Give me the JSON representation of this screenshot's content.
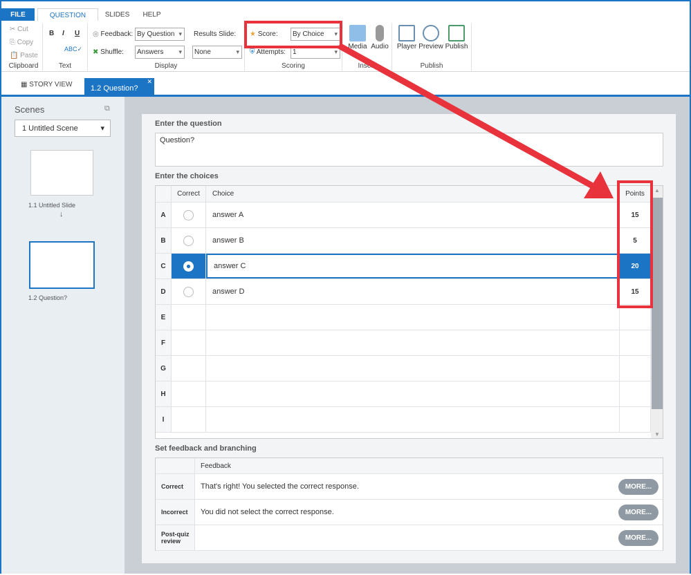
{
  "ribbon_tabs": [
    "FILE",
    "QUESTION",
    "SLIDES",
    "HELP"
  ],
  "clipboard": {
    "cut": "Cut",
    "copy": "Copy",
    "paste": "Paste",
    "group": "Clipboard"
  },
  "text": {
    "bold": "B",
    "italic": "I",
    "underline": "U",
    "group": "Text"
  },
  "display": {
    "feedback_label": "Feedback:",
    "feedback_value": "By Question",
    "shuffle_label": "Shuffle:",
    "shuffle_value": "Answers",
    "results_label": "Results Slide:",
    "results_value": "None",
    "group": "Display"
  },
  "scoring": {
    "score_label": "Score:",
    "score_value": "By Choice",
    "attempts_label": "Attempts:",
    "attempts_value": "1",
    "group": "Scoring"
  },
  "insert": {
    "media": "Media",
    "audio": "Audio",
    "group": "Insert"
  },
  "publish": {
    "player": "Player",
    "preview": "Preview",
    "publish": "Publish",
    "group": "Publish"
  },
  "doc_tabs": {
    "story_view": "STORY VIEW",
    "active": "1.2 Question?"
  },
  "sidebar": {
    "title": "Scenes",
    "scene": "1 Untitled Scene",
    "slides": [
      {
        "label": "1.1 Untitled Slide"
      },
      {
        "label": "1.2 Question?"
      }
    ]
  },
  "question": {
    "heading": "Enter the question",
    "value": "Question?"
  },
  "choices": {
    "heading": "Enter the choices",
    "headers": {
      "correct": "Correct",
      "choice": "Choice",
      "points": "Points"
    },
    "rows": [
      {
        "letter": "A",
        "text": "answer A",
        "points": "15"
      },
      {
        "letter": "B",
        "text": "answer B",
        "points": "5"
      },
      {
        "letter": "C",
        "text": "answer C",
        "points": "20"
      },
      {
        "letter": "D",
        "text": "answer D",
        "points": "15"
      },
      {
        "letter": "E",
        "text": "",
        "points": ""
      },
      {
        "letter": "F",
        "text": "",
        "points": ""
      },
      {
        "letter": "G",
        "text": "",
        "points": ""
      },
      {
        "letter": "H",
        "text": "",
        "points": ""
      },
      {
        "letter": "I",
        "text": "",
        "points": ""
      }
    ]
  },
  "feedback": {
    "heading": "Set feedback and branching",
    "header": "Feedback",
    "more": "MORE...",
    "rows": [
      {
        "label": "Correct",
        "text": "That's right!  You selected the correct response."
      },
      {
        "label": "Incorrect",
        "text": "You did not select the correct response."
      },
      {
        "label": "Post-quiz review",
        "text": ""
      }
    ]
  },
  "colors": {
    "accent": "#1c74c4",
    "annotation": "#e8323c"
  }
}
